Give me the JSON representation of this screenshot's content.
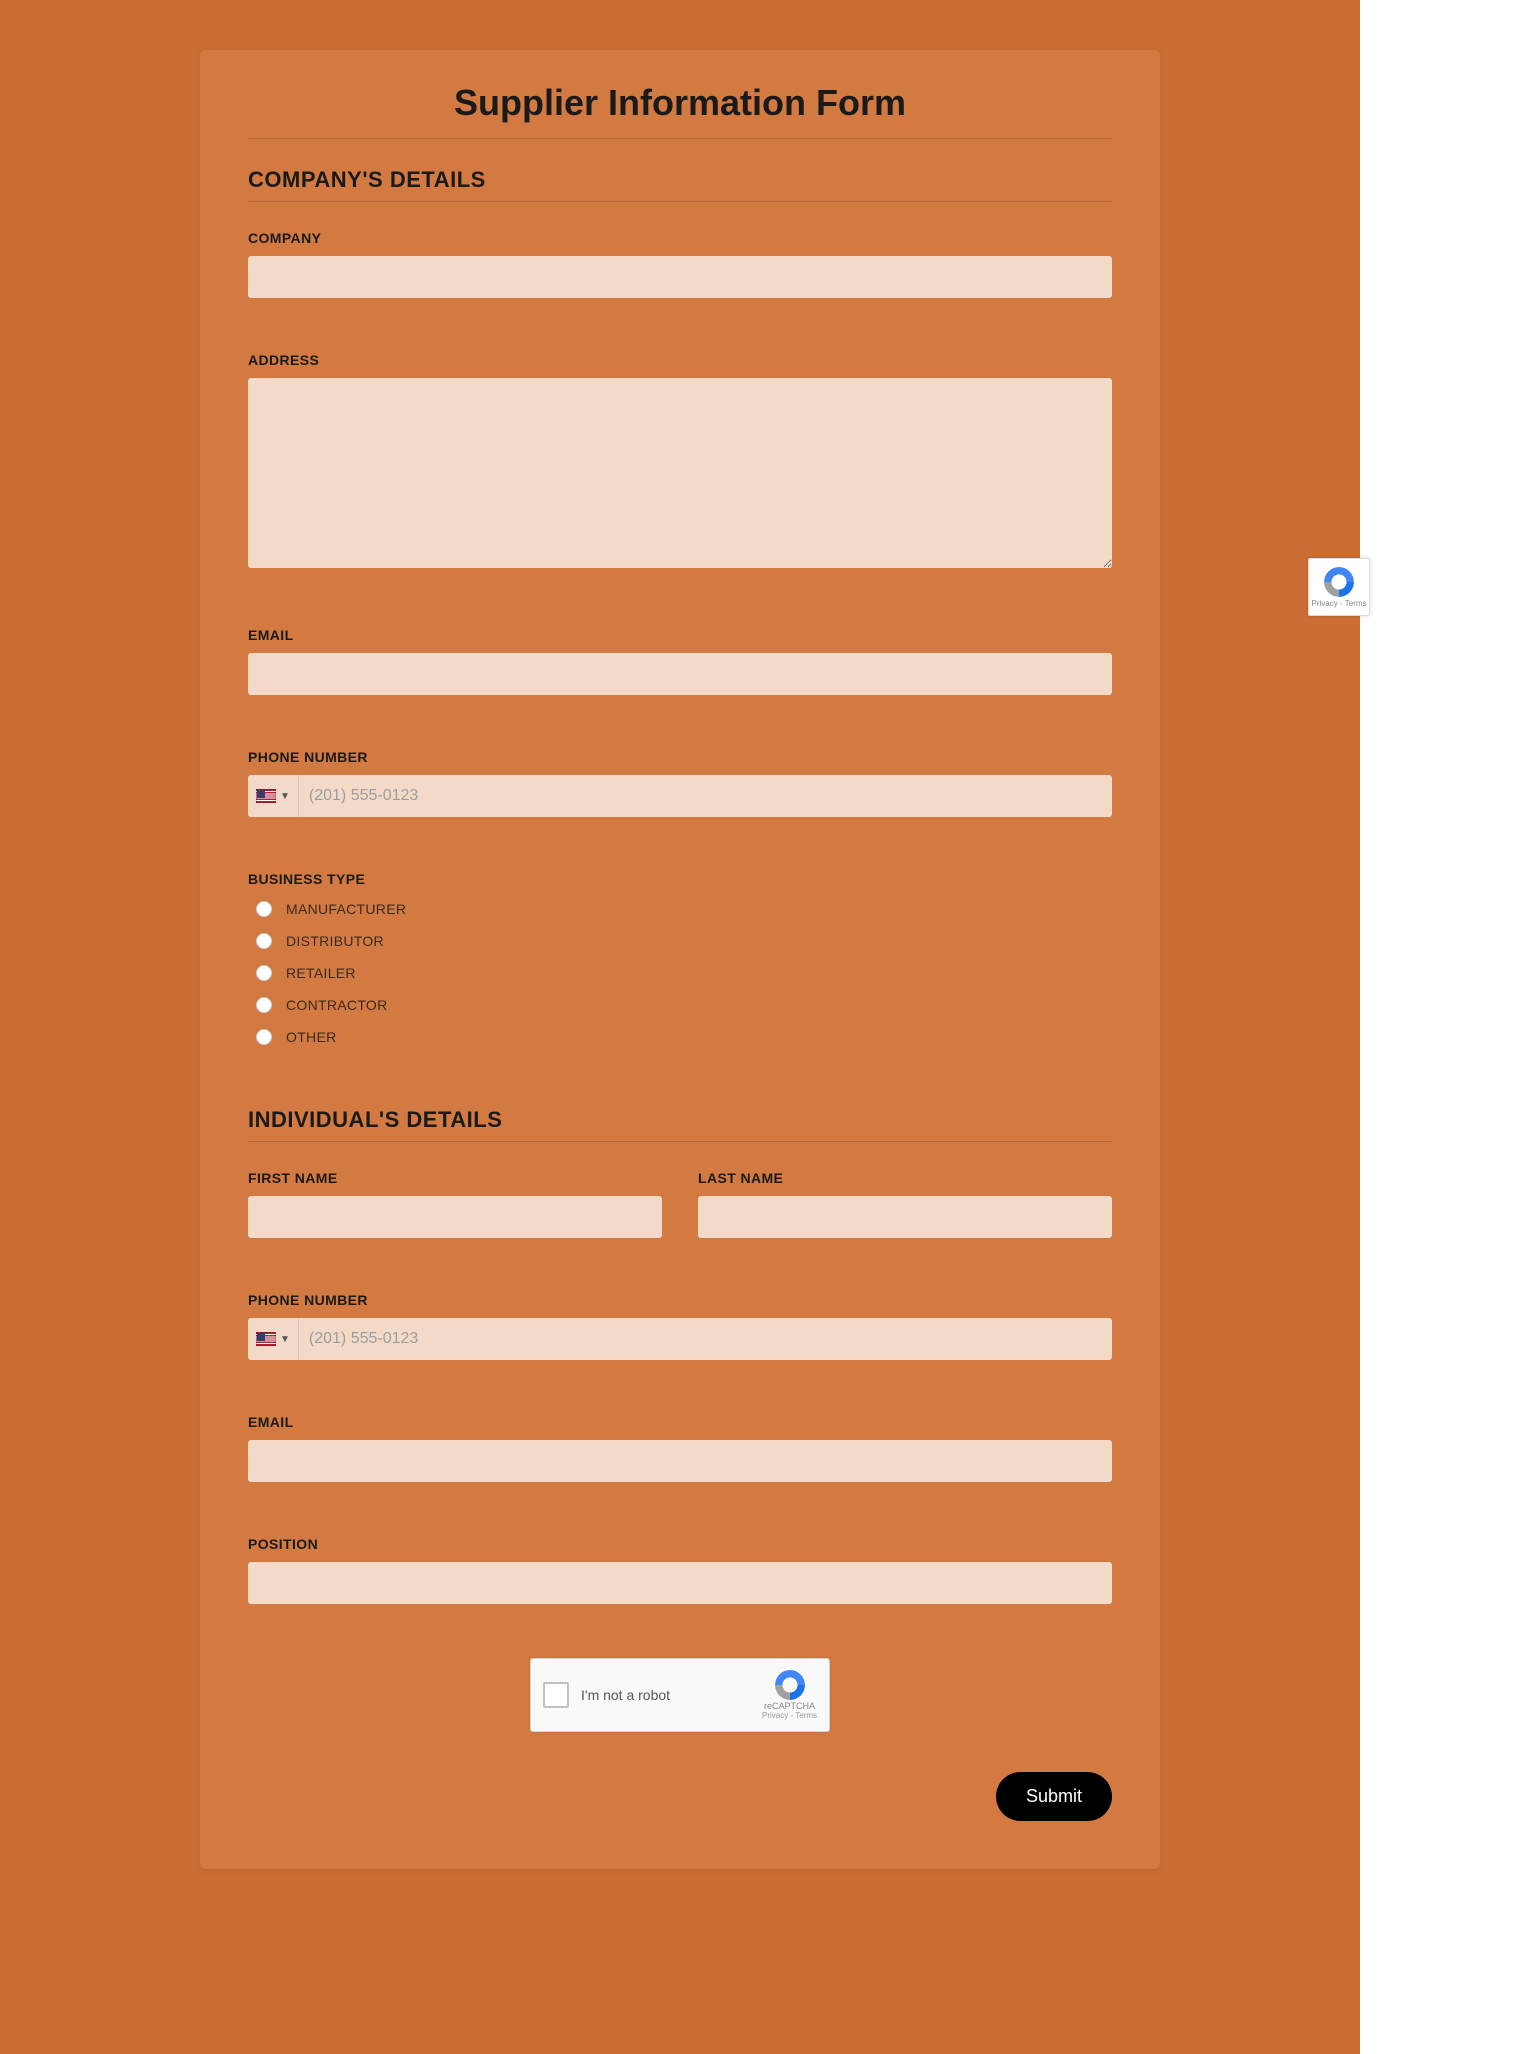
{
  "form": {
    "title": "Supplier Information Form",
    "sections": {
      "company": {
        "heading": "COMPANY'S DETAILS",
        "fields": {
          "company_label": "COMPANY",
          "address_label": "ADDRESS",
          "email_label": "EMAIL",
          "phone_label": "PHONE NUMBER",
          "phone_placeholder": "(201) 555-0123",
          "business_type_label": "BUSINESS TYPE",
          "business_type_options": [
            "MANUFACTURER",
            "DISTRIBUTOR",
            "RETAILER",
            "CONTRACTOR",
            "OTHER"
          ]
        }
      },
      "individual": {
        "heading": "INDIVIDUAL'S DETAILS",
        "fields": {
          "first_name_label": "FIRST NAME",
          "last_name_label": "LAST NAME",
          "phone_label": "PHONE NUMBER",
          "phone_placeholder": "(201) 555-0123",
          "email_label": "EMAIL",
          "position_label": "POSITION"
        }
      }
    },
    "recaptcha": {
      "checkbox_text": "I'm not a robot",
      "brand": "reCAPTCHA",
      "links": "Privacy - Terms"
    },
    "submit_label": "Submit"
  },
  "badge": {
    "links": "Privacy - Terms"
  }
}
